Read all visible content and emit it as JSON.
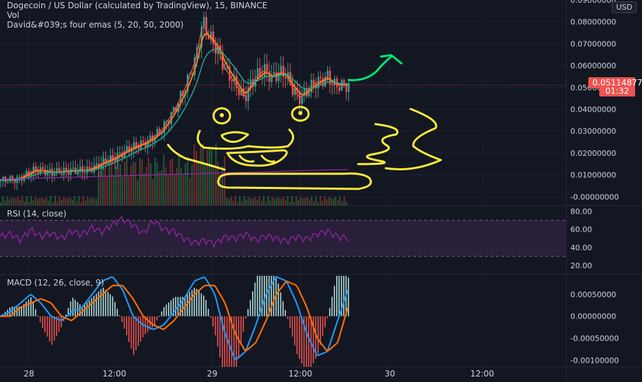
{
  "header": {
    "symbol_line": "Dogecoin / US Dollar (calculated by TradingView), 15, BINANCE",
    "vol_label": "Vol",
    "ema_label": "David&#039;s four emas (5, 20, 50, 2000)",
    "currency": "USD"
  },
  "price_tag": {
    "value": "0.05114877",
    "countdown": "01:32"
  },
  "rsi_label": "RSI (14, close)",
  "macd_label": "MACD (12, 26, close, 9)",
  "colors": {
    "background": "#131722",
    "grid": "#1f2330",
    "up": "#26a69a",
    "down": "#ef5350",
    "ema_fast": "#ef5350",
    "ema_mid": "#f57c20",
    "ema_slow": "#26a69a",
    "ema_long": "#9c27b0",
    "rsi": "#9c27b0",
    "macd": "#2196f3",
    "signal": "#ff6d00",
    "drawing_yellow": "#ffeb3b",
    "drawing_green": "#00e676",
    "price_tag": "#ef5350"
  },
  "chart_data": [
    {
      "type": "candlestick",
      "title": "Dogecoin / US Dollar (calculated by TradingView), 15, BINANCE",
      "x_ticks": [
        "28",
        "12:00",
        "29",
        "12:00",
        "30",
        "12:00"
      ],
      "y_ticks": [
        "0.09000000",
        "0.08000000",
        "0.07000000",
        "0.06000000",
        "0.05000000",
        "0.04000000",
        "0.03000000",
        "0.02000000",
        "0.01000000",
        "-0.00000000"
      ],
      "ylim": [
        -0.004,
        0.09
      ],
      "last_price": 0.05114877,
      "series": [
        {
          "name": "price (approx. close)",
          "x": [
            0,
            0.05,
            0.1,
            0.15,
            0.2,
            0.25,
            0.3,
            0.33,
            0.37,
            0.42,
            0.46,
            0.5,
            0.53,
            0.56,
            0.58,
            0.6,
            0.62,
            0.63,
            0.645,
            0.66,
            0.68,
            0.7,
            0.72,
            0.74,
            0.76,
            0.78,
            0.8,
            0.82,
            0.84,
            0.86,
            0.88,
            0.9,
            0.92,
            0.94,
            0.96
          ],
          "values": [
            0.0075,
            0.008,
            0.0125,
            0.011,
            0.012,
            0.012,
            0.016,
            0.018,
            0.022,
            0.025,
            0.03,
            0.04,
            0.05,
            0.063,
            0.08,
            0.073,
            0.068,
            0.065,
            0.058,
            0.055,
            0.05,
            0.045,
            0.052,
            0.056,
            0.058,
            0.054,
            0.057,
            0.056,
            0.049,
            0.045,
            0.048,
            0.052,
            0.053,
            0.055,
            0.051
          ]
        }
      ]
    },
    {
      "type": "line",
      "title": "RSI (14, close)",
      "y_ticks": [
        "80.00",
        "60.00",
        "40.00",
        "20.00"
      ],
      "ylim": [
        10,
        85
      ],
      "bands": [
        30,
        70
      ],
      "series": [
        {
          "name": "RSI",
          "values": [
            52,
            55,
            48,
            60,
            52,
            56,
            50,
            58,
            54,
            62,
            57,
            66,
            72,
            65,
            55,
            70,
            60,
            58,
            50,
            45,
            48,
            44,
            52,
            50,
            55,
            48,
            53,
            50,
            47,
            52,
            49,
            55,
            58,
            52,
            50
          ]
        }
      ]
    },
    {
      "type": "bar",
      "title": "MACD (12, 26, close, 9)",
      "y_ticks": [
        "0.00050000",
        "0.00000000",
        "-0.00050000",
        "-0.00100000"
      ],
      "ylim": [
        -0.00115,
        0.00092
      ],
      "series": [
        {
          "name": "MACD",
          "values": [
            0.0,
            0.0001,
            0.0003,
            0.0005,
            0.0003,
            0.0,
            -0.0001,
            0.0001,
            0.0002,
            0.0005,
            0.0008,
            0.0009,
            0.0006,
            0.0,
            -0.0002,
            -0.0003,
            -0.0002,
            0.0001,
            0.0004,
            0.0008,
            0.0009,
            0.0005,
            -0.0004,
            -0.001,
            -0.0008,
            -0.0002,
            0.0005,
            0.0009,
            0.0008,
            0.0003,
            -0.0004,
            -0.0009,
            -0.0008,
            -0.0001,
            0.0006
          ]
        },
        {
          "name": "signal",
          "values": [
            0.0,
            0.0,
            0.0002,
            0.0003,
            0.0004,
            0.0003,
            0.0,
            -0.0001,
            0.0001,
            0.0003,
            0.0005,
            0.0007,
            0.0007,
            0.0004,
            0.0,
            -0.0002,
            -0.0003,
            -0.0001,
            0.0002,
            0.0005,
            0.0007,
            0.0007,
            0.0003,
            -0.0004,
            -0.0008,
            -0.0006,
            -0.0001,
            0.0005,
            0.0008,
            0.0007,
            0.0002,
            -0.0005,
            -0.0008,
            -0.0006,
            0.0002
          ]
        }
      ]
    }
  ]
}
